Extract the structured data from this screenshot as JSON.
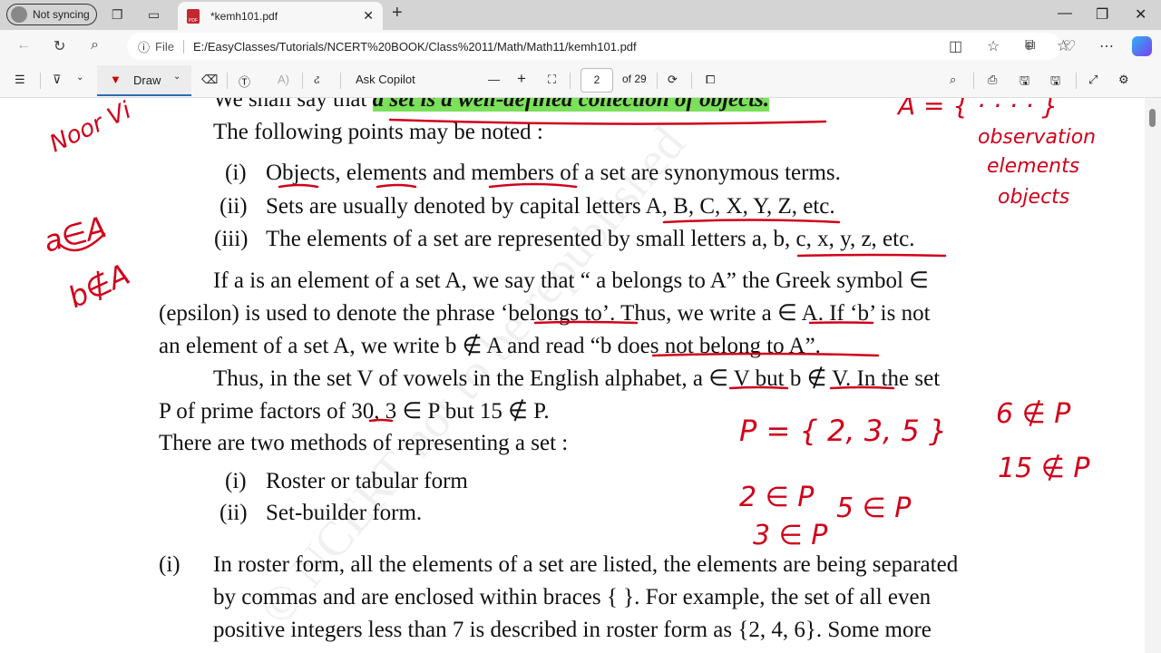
{
  "browser": {
    "profile": "Not syncing",
    "tab_title": "*kemh101.pdf",
    "url_scheme": "File",
    "url": "E:/EasyClasses/Tutorials/NCERT%20BOOK/Class%2011/Math/Math11/kemh101.pdf"
  },
  "toolbar": {
    "draw": "Draw",
    "ask_copilot": "Ask Copilot",
    "page": "2",
    "page_total": "of 29"
  },
  "doc": {
    "lines": [
      "The following points may be noted :",
      "Objects, elements and members of a set are synonymous  terms.",
      "Sets are usually denoted by capital letters A, B, C, X, Y, Z, etc.",
      "The elements of a set are represented by small letters a, b, c, x, y, z, etc.",
      "If a is an element of a set A, we say that “ a belongs to A” the Greek symbol ∈",
      "(epsilon) is used to denote the phrase ‘belongs to’. Thus, we write a ∈ A. If ‘b’ is not",
      "an element of a set A, we write b ∉ A and read  “b does not belong to A”.",
      "Thus, in the set V of vowels in the English alphabet, a ∈ V but b ∉ V. In the set",
      "P of prime factors of 30, 3 ∈ P but 15 ∉ P.",
      "There are two methods of representing a set :",
      "Roster or tabular form",
      "Set-builder form.",
      "In roster form, all the elements of a set are listed, the elements are being separated",
      "by commas and are enclosed within braces {   }. For example, the set of all even",
      "positive integers less than 7 is described in roster form as {2, 4, 6}. Some more"
    ],
    "top_prefix": "We shall say that ",
    "top_highlight": "a set is a well-defined collection of objects.",
    "labels": [
      "(i)",
      "(ii)",
      "(iii)",
      "(i)",
      "(ii)",
      "(i)"
    ],
    "watermark": "© NCERT not to be republished"
  },
  "annotations": {
    "name": "Noor Vi",
    "a_in_A": "a∈A",
    "b_notin_A": "b∉A",
    "A_set": "A = { · · · · }",
    "obs1": "observation",
    "obs2": "elements",
    "obs3": "objects",
    "P_set": "P = { 2, 3, 5 }",
    "six": "6 ∉ P",
    "fifteen": "15 ∉ P",
    "two": "2 ∈ P",
    "three": "3 ∈ P",
    "five": "5 ∈ P"
  },
  "colors": {
    "ink": "#d0021b",
    "highlight": "#7be05a"
  }
}
